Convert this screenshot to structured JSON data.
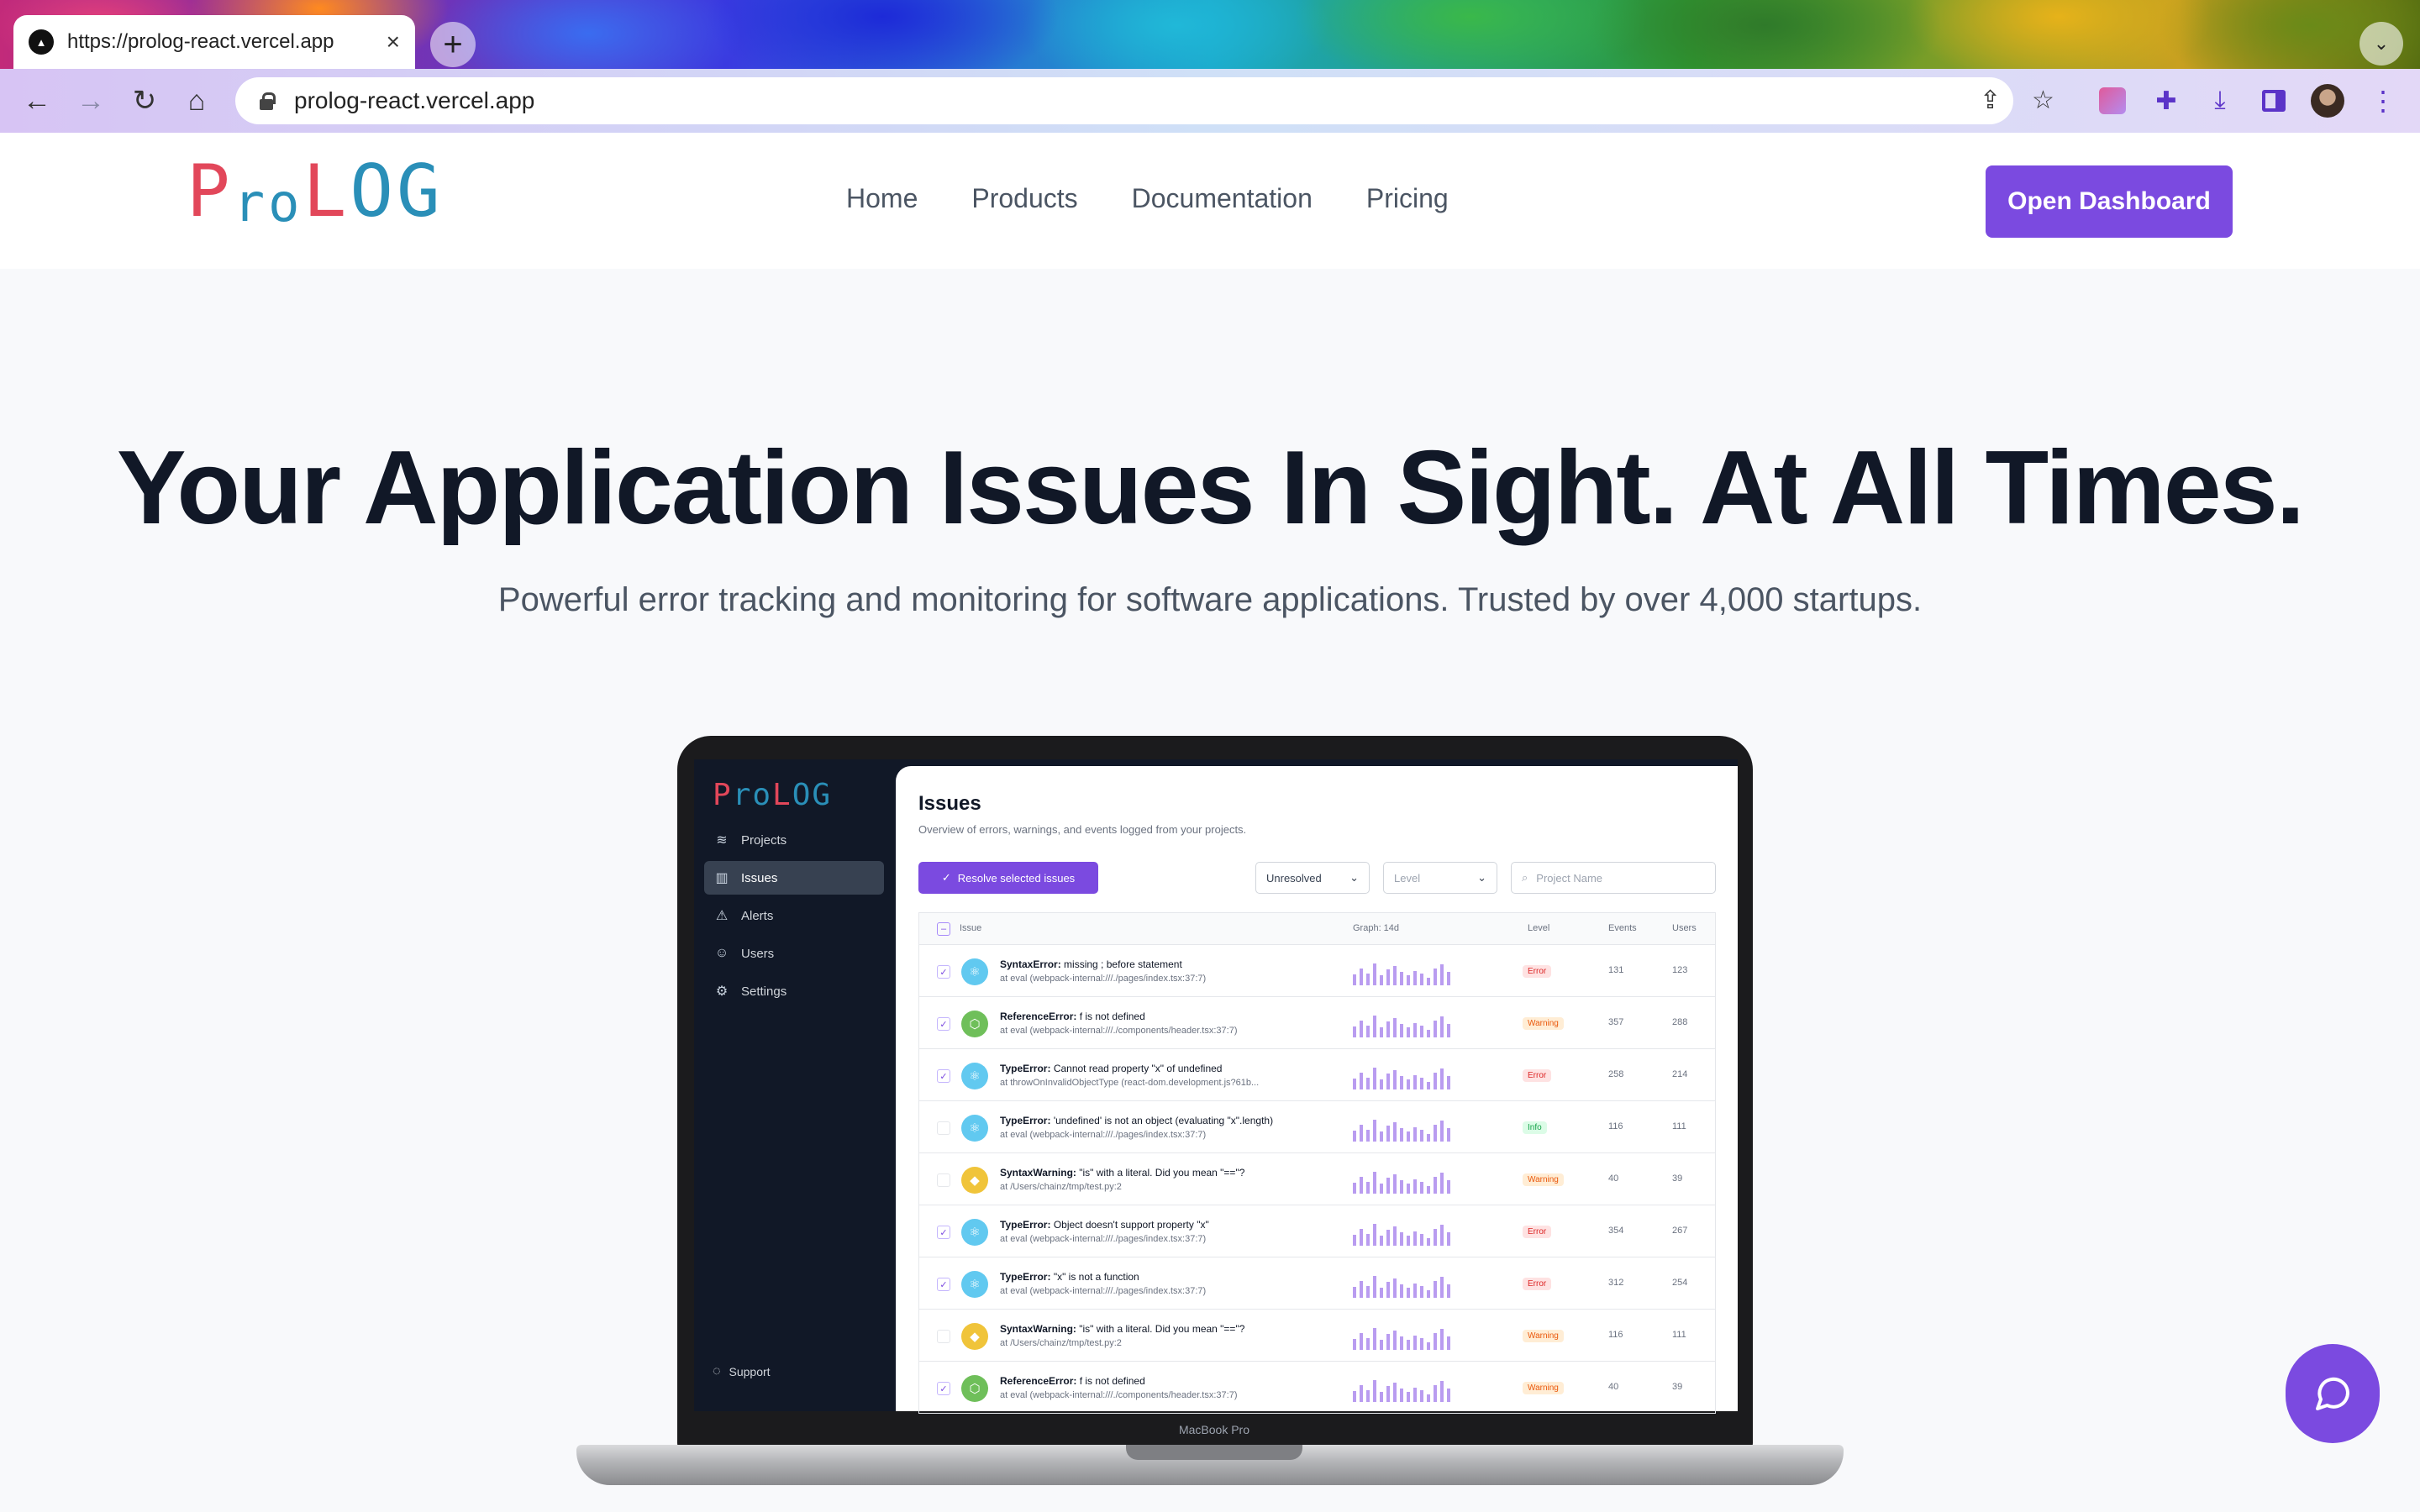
{
  "browser": {
    "tab_title": "https://prolog-react.vercel.app",
    "url": "prolog-react.vercel.app"
  },
  "site": {
    "logo": {
      "p": "P",
      "ro": "ro",
      "l": "L",
      "og": "OG"
    },
    "nav": [
      "Home",
      "Products",
      "Documentation",
      "Pricing"
    ],
    "cta": "Open Dashboard",
    "hero_title": "Your Application Issues In Sight. At All Times.",
    "hero_subtitle": "Powerful error tracking and monitoring for software applications. Trusted by over 4,000 startups."
  },
  "app": {
    "logo": "ProLOG",
    "sidebar": [
      {
        "label": "Projects",
        "icon": "layers-icon"
      },
      {
        "label": "Issues",
        "icon": "bar-chart-icon",
        "active": true
      },
      {
        "label": "Alerts",
        "icon": "alert-triangle-icon"
      },
      {
        "label": "Users",
        "icon": "users-icon"
      },
      {
        "label": "Settings",
        "icon": "gear-icon"
      }
    ],
    "support": "Support",
    "title": "Issues",
    "subtitle": "Overview of errors, warnings, and events logged from your projects.",
    "resolve_label": "Resolve selected issues",
    "status_select": "Unresolved",
    "level_select": "Level",
    "search_placeholder": "Project Name",
    "columns": {
      "issue": "Issue",
      "graph": "Graph: 14d",
      "level": "Level",
      "events": "Events",
      "users": "Users"
    },
    "rows": [
      {
        "checked": true,
        "platform": "react",
        "name": "SyntaxError:",
        "message": "missing ; before statement",
        "location": "at eval (webpack-internal:///./pages/index.tsx:37:7)",
        "level": "Error",
        "events": "131",
        "users": "123"
      },
      {
        "checked": true,
        "platform": "node",
        "name": "ReferenceError:",
        "message": "f is not defined",
        "location": "at eval (webpack-internal:///./components/header.tsx:37:7)",
        "level": "Warning",
        "events": "357",
        "users": "288"
      },
      {
        "checked": true,
        "platform": "react",
        "name": "TypeError:",
        "message": "Cannot read property \"x\" of undefined",
        "location": "at throwOnInvalidObjectType (react-dom.development.js?61b...",
        "level": "Error",
        "events": "258",
        "users": "214"
      },
      {
        "checked": false,
        "platform": "react",
        "name": "TypeError:",
        "message": "'undefined' is not an object (evaluating \"x\".length)",
        "location": "at eval (webpack-internal:///./pages/index.tsx:37:7)",
        "level": "Info",
        "events": "116",
        "users": "111"
      },
      {
        "checked": false,
        "platform": "python",
        "name": "SyntaxWarning:",
        "message": "\"is\" with a literal. Did you mean \"==\"?",
        "location": "at /Users/chainz/tmp/test.py:2",
        "level": "Warning",
        "events": "40",
        "users": "39"
      },
      {
        "checked": true,
        "platform": "react",
        "name": "TypeError:",
        "message": "Object doesn't support property \"x\"",
        "location": "at eval (webpack-internal:///./pages/index.tsx:37:7)",
        "level": "Error",
        "events": "354",
        "users": "267"
      },
      {
        "checked": true,
        "platform": "react",
        "name": "TypeError:",
        "message": "\"x\" is not a function",
        "location": "at eval (webpack-internal:///./pages/index.tsx:37:7)",
        "level": "Error",
        "events": "312",
        "users": "254"
      },
      {
        "checked": false,
        "platform": "python",
        "name": "SyntaxWarning:",
        "message": "\"is\" with a literal. Did you mean \"==\"?",
        "location": "at /Users/chainz/tmp/test.py:2",
        "level": "Warning",
        "events": "116",
        "users": "111"
      },
      {
        "checked": true,
        "platform": "node",
        "name": "ReferenceError:",
        "message": "f is not defined",
        "location": "at eval (webpack-internal:///./components/header.tsx:37:7)",
        "level": "Warning",
        "events": "40",
        "users": "39"
      }
    ],
    "graph_bars": [
      9,
      14,
      10,
      18,
      8,
      13,
      16,
      11,
      8,
      12,
      10,
      6,
      14,
      17,
      11
    ]
  },
  "device_label": "MacBook Pro",
  "colors": {
    "accent": "#7b4ae0",
    "logo_red": "#e2475a",
    "logo_blue": "#2a8fb8",
    "sidebar_bg": "#111827"
  }
}
